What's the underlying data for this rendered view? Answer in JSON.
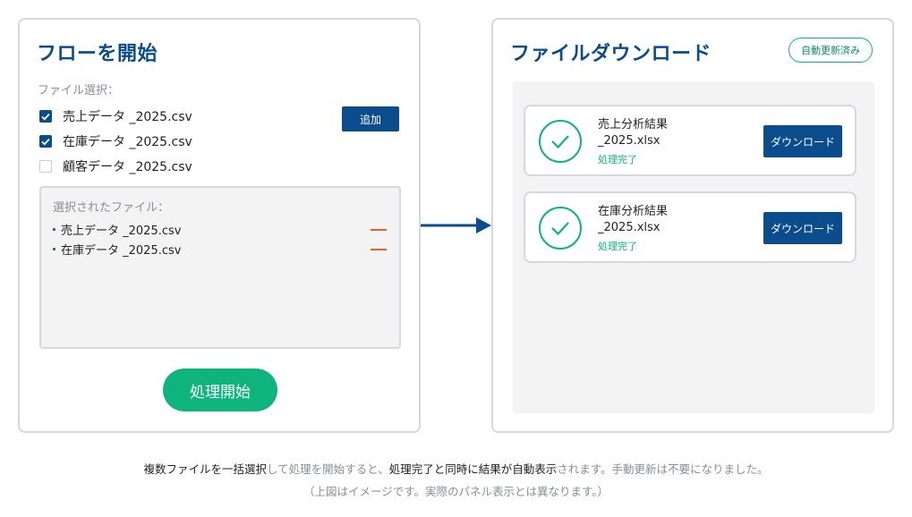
{
  "left_panel": {
    "title": "フローを開始",
    "file_select_label": "ファイル選択：",
    "files": [
      {
        "name": "売上データ _2025.csv",
        "checked": true
      },
      {
        "name": "在庫データ _2025.csv",
        "checked": true
      },
      {
        "name": "顧客データ _2025.csv",
        "checked": false
      }
    ],
    "add_button": "追加",
    "selected_label": "選択されたファイル：",
    "selected_files": [
      "売上データ _2025.csv",
      "在庫データ _2025.csv"
    ],
    "start_button": "処理開始"
  },
  "right_panel": {
    "title": "ファイルダウンロード",
    "badge": "自動更新済み",
    "downloads": [
      {
        "name_line1": "売上分析結果",
        "name_line2": "_2025.xlsx",
        "status": "処理完了",
        "button": "ダウンロード"
      },
      {
        "name_line1": "在庫分析結果",
        "name_line2": "_2025.xlsx",
        "status": "処理完了",
        "button": "ダウンロード"
      }
    ]
  },
  "caption": {
    "line1": [
      {
        "text": "複数ファイルを一括選択",
        "style": "dark"
      },
      {
        "text": "して処理を開始すると、",
        "style": "grey"
      },
      {
        "text": "処理完了と同時に結果が自動表示",
        "style": "dark"
      },
      {
        "text": "されます。手動更新は不要になりました。",
        "style": "grey"
      }
    ],
    "line2": "（上図はイメージです。実際のパネル表示とは異なります。）"
  },
  "colors": {
    "primary": "#0a4c8c",
    "success": "#0fb47c",
    "remove": "#e0612c"
  },
  "icons": {
    "check": "check-icon",
    "success": "check-circle-icon",
    "arrow": "arrow-right-icon",
    "remove": "minus-icon"
  }
}
